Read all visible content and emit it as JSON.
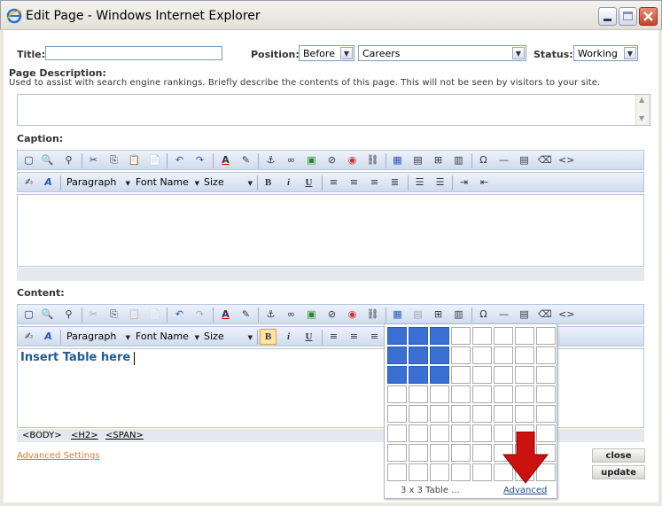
{
  "window": {
    "title": "Edit Page - Windows Internet Explorer",
    "brand_color": "#3a6fd3"
  },
  "form": {
    "title_label": "Title:",
    "title_value": "",
    "position_label": "Position:",
    "position_value": "Before",
    "parent_value": "Careers",
    "status_label": "Status:",
    "status_value": "Working",
    "page_desc_label": "Page Description:",
    "page_desc_help": "Used to assist with search engine rankings. Briefly describe the contents of this page. This will not be seen by visitors to your site.",
    "caption_label": "Caption:",
    "content_label": "Content:"
  },
  "toolbar": {
    "paragraph": "Paragraph",
    "font_name": "Font Name",
    "size": "Size",
    "bold": "B",
    "italic": "i",
    "underline": "U"
  },
  "content": {
    "text": "Insert Table here"
  },
  "status_path": [
    "<BODY>",
    "<H2>",
    "<SPAN>"
  ],
  "links": {
    "advanced_settings": "Advanced Settings"
  },
  "buttons": {
    "close": "close",
    "update": "update"
  },
  "table_popup": {
    "grid_rows": 8,
    "grid_cols": 8,
    "selected_rows": 3,
    "selected_cols": 3,
    "label": "3 x 3 Table ...",
    "advanced": "Advanced"
  }
}
